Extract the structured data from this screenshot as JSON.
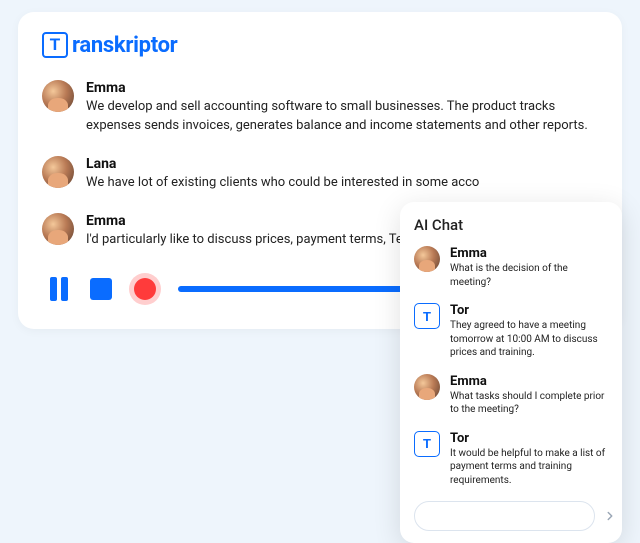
{
  "brand": {
    "name": "ranskriptor",
    "icon_letter": "T"
  },
  "transcript": [
    {
      "speaker": "Emma",
      "text": "We develop and sell accounting software to small businesses. The product tracks expenses sends invoices, generates balance and income statements and other reports."
    },
    {
      "speaker": "Lana",
      "text": "We have lot of existing clients who could be interested in some acco"
    },
    {
      "speaker": "Emma",
      "text": "I'd particularly like to discuss prices, payment terms, Technical Supp"
    }
  ],
  "player": {
    "progress_percent": 60
  },
  "chat": {
    "title": "AI Chat",
    "messages": [
      {
        "sender": "Emma",
        "is_bot": false,
        "text": "What is the decision of the meeting?"
      },
      {
        "sender": "Tor",
        "is_bot": true,
        "text": "They agreed to have a meeting tomorrow at 10:00 AM to discuss prices and training."
      },
      {
        "sender": "Emma",
        "is_bot": false,
        "text": "What tasks should I complete prior to the meeting?"
      },
      {
        "sender": "Tor",
        "is_bot": true,
        "text": "It would be helpful to make a list of payment terms and training requirements."
      }
    ],
    "input_placeholder": ""
  },
  "colors": {
    "accent": "#0a6cff",
    "record": "#ff3b3b"
  }
}
